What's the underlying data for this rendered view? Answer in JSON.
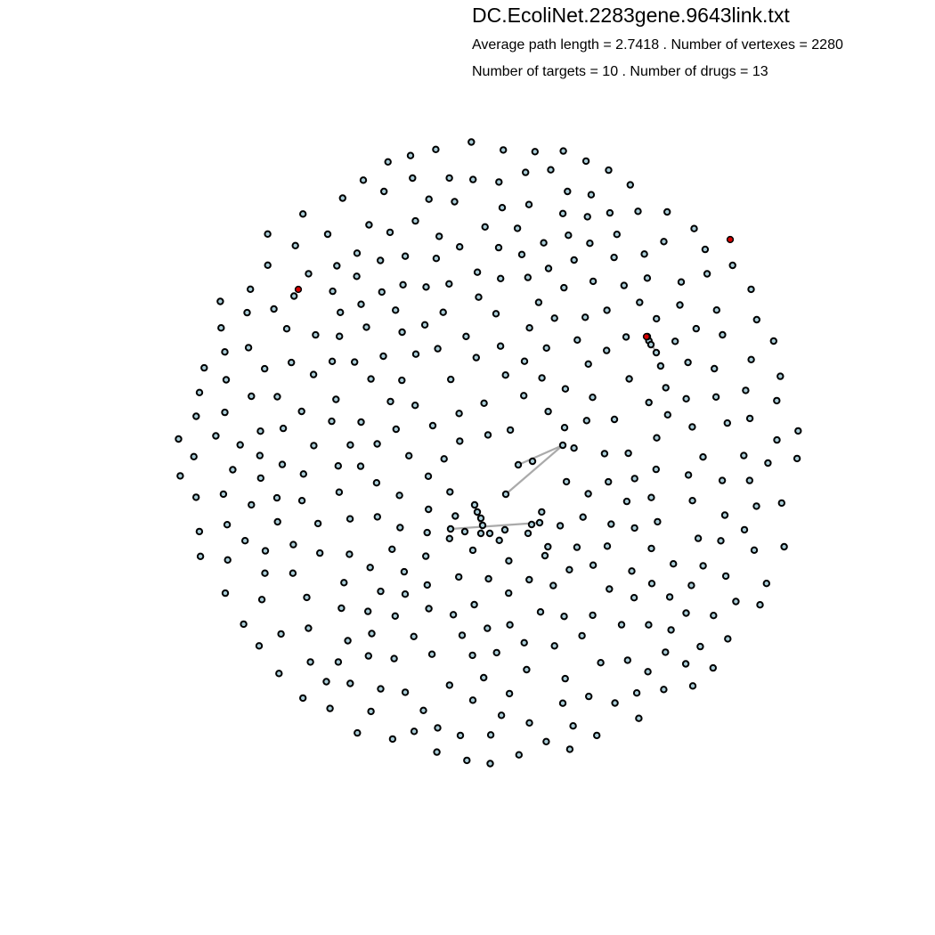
{
  "figure": {
    "title": "DC.EcoliNet.2283gene.9643link.txt",
    "stats_line_1": "Average path length = 2.7418 . Number of vertexes = 2280",
    "stats_line_2": "Number of targets = 10 . Number of drugs = 13"
  },
  "colors": {
    "node_fill": "#a9cdd8",
    "target_fill": "#d40000",
    "node_stroke": "#000000",
    "edge": "#aaaaaa"
  },
  "network": {
    "layout": "random scatter of mostly isolated nodes in a disc",
    "highlighted_targets": 3,
    "edges_visible": true
  }
}
